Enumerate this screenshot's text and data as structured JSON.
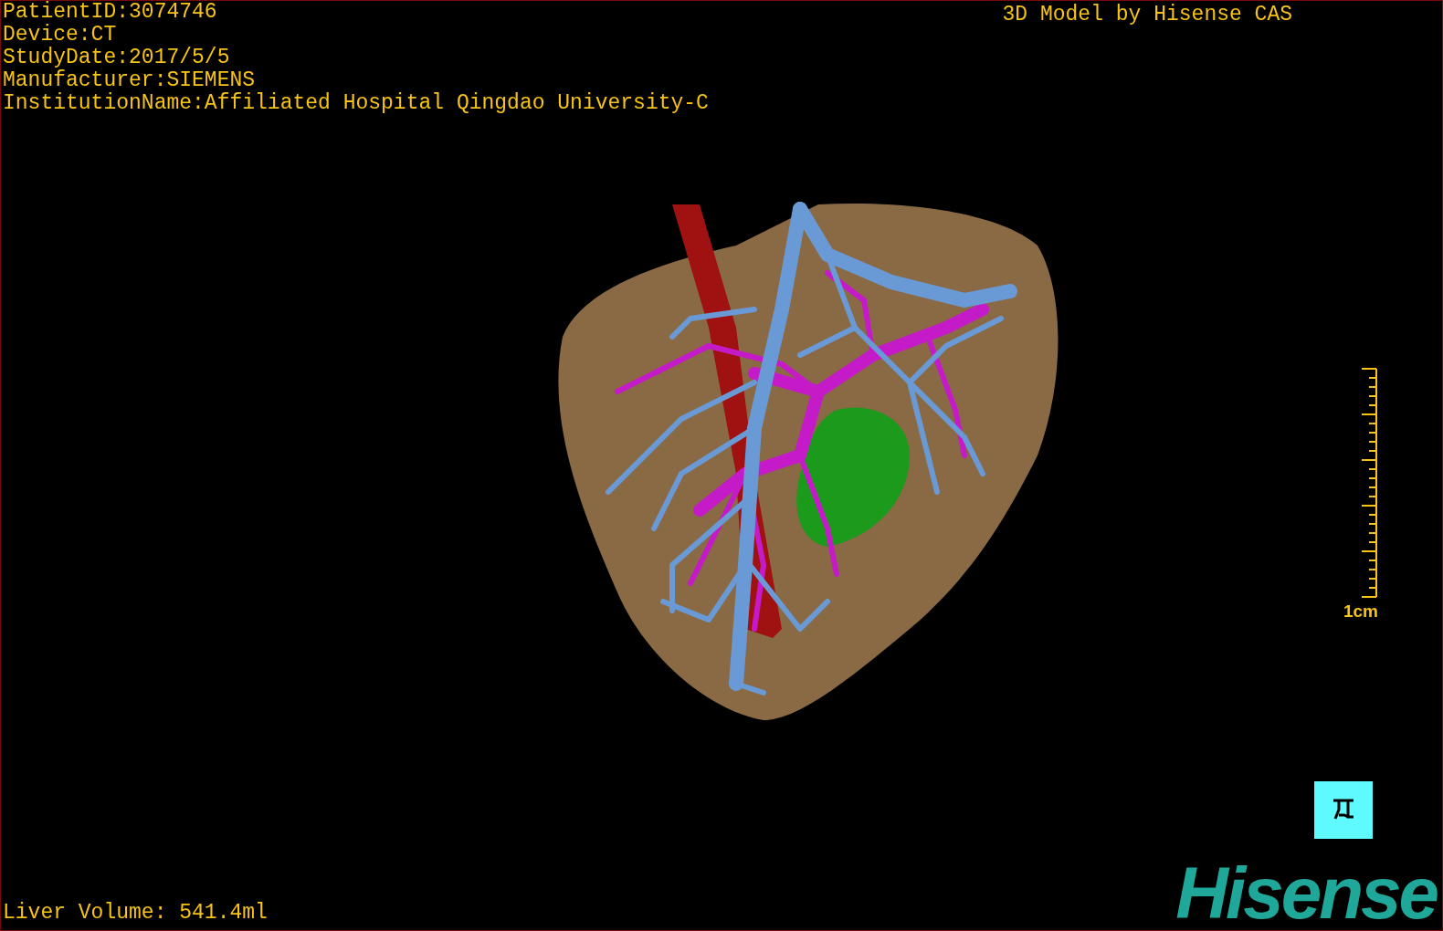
{
  "patient_info": [
    "PatientID:3074746",
    "Device:CT",
    "StudyDate:2017/5/5",
    "Manufacturer:SIEMENS",
    "InstitutionName:Affiliated Hospital Qingdao University-C"
  ],
  "header_title": "3D Model by Hisense CAS",
  "scale_bar": {
    "label": "1cm"
  },
  "liver_volume": "Liver Volume: 541.4ml",
  "logo": "Hisense"
}
